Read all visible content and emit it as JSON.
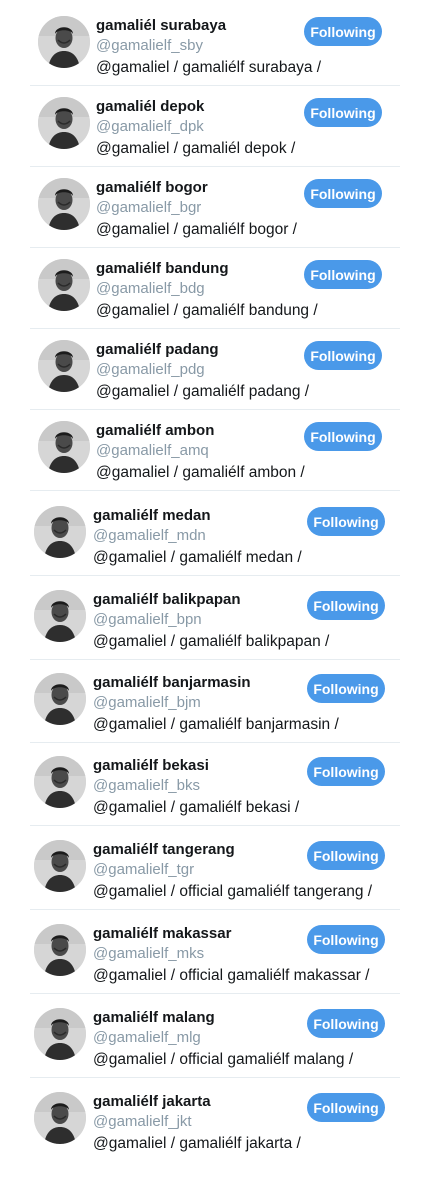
{
  "following_button_label": "Following",
  "accent_color": "#4a99e9",
  "accounts": [
    {
      "name": "gamaliél surabaya",
      "handle": "@gamalielf_sby",
      "bio": "@gamaliel / gamaliélf surabaya /",
      "avatar_icon": "profile-photo"
    },
    {
      "name": "gamaliél depok",
      "handle": "@gamalielf_dpk",
      "bio": "@gamaliel / gamaliél depok /",
      "avatar_icon": "profile-photo"
    },
    {
      "name": "gamaliélf bogor",
      "handle": "@gamalielf_bgr",
      "bio": "@gamaliel / gamaliélf bogor /",
      "avatar_icon": "profile-photo"
    },
    {
      "name": "gamaliélf bandung",
      "handle": "@gamalielf_bdg",
      "bio": "@gamaliel / gamaliélf bandung /",
      "avatar_icon": "profile-photo"
    },
    {
      "name": "gamaliélf padang",
      "handle": "@gamalielf_pdg",
      "bio": "@gamaliel / gamaliélf padang /",
      "avatar_icon": "profile-photo"
    },
    {
      "name": "gamaliélf ambon",
      "handle": "@gamalielf_amq",
      "bio": "@gamaliel / gamaliélf ambon /",
      "avatar_icon": "profile-photo"
    },
    {
      "name": "gamaliélf medan",
      "handle": "@gamalielf_mdn",
      "bio": "@gamaliel / gamaliélf medan /",
      "avatar_icon": "profile-photo"
    },
    {
      "name": "gamaliélf balikpapan",
      "handle": "@gamalielf_bpn",
      "bio": "@gamaliel / gamaliélf balikpapan /",
      "avatar_icon": "profile-photo"
    },
    {
      "name": "gamaliélf banjarmasin",
      "handle": "@gamalielf_bjm",
      "bio": "@gamaliel / gamaliélf banjarmasin /",
      "avatar_icon": "profile-photo"
    },
    {
      "name": "gamaliélf bekasi",
      "handle": "@gamalielf_bks",
      "bio": "@gamaliel / gamaliélf bekasi /",
      "avatar_icon": "profile-photo"
    },
    {
      "name": "gamaliélf tangerang",
      "handle": "@gamalielf_tgr",
      "bio": "@gamaliel / official gamaliélf tangerang /",
      "avatar_icon": "profile-photo"
    },
    {
      "name": "gamaliélf makassar",
      "handle": "@gamalielf_mks",
      "bio": "@gamaliel / official gamaliélf makassar /",
      "avatar_icon": "profile-photo"
    },
    {
      "name": "gamaliélf malang",
      "handle": "@gamalielf_mlg",
      "bio": "@gamaliel / official gamaliélf malang /",
      "avatar_icon": "profile-photo"
    },
    {
      "name": "gamaliélf jakarta",
      "handle": "@gamalielf_jkt",
      "bio": "@gamaliel / gamaliélf jakarta /",
      "avatar_icon": "profile-photo"
    }
  ]
}
